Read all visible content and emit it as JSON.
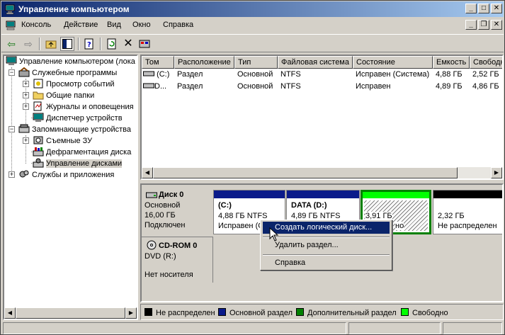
{
  "window": {
    "title": "Управление компьютером"
  },
  "menu": {
    "items": [
      "Консоль",
      "Действие",
      "Вид",
      "Окно",
      "Справка"
    ]
  },
  "tree": {
    "root": "Управление компьютером (лока",
    "system_tools": "Служебные программы",
    "event_viewer": "Просмотр событий",
    "shared_folders": "Общие папки",
    "logs_alerts": "Журналы и оповещения",
    "device_manager": "Диспетчер устройств",
    "storage": "Запоминающие устройства",
    "removable": "Съемные ЗУ",
    "defrag": "Дефрагментация диска",
    "disk_mgmt": "Управление дисками",
    "services_apps": "Службы и приложения"
  },
  "volumes": {
    "columns": [
      "Том",
      "Расположение",
      "Тип",
      "Файловая система",
      "Состояние",
      "Емкость",
      "Свободно"
    ],
    "rows": [
      [
        "(C:)",
        "Раздел",
        "Основной",
        "NTFS",
        "Исправен (Система)",
        "4,88 ГБ",
        "2,52 ГБ"
      ],
      [
        "D...",
        "Раздел",
        "Основной",
        "NTFS",
        "Исправен",
        "4,89 ГБ",
        "4,86 ГБ"
      ]
    ]
  },
  "disks": {
    "disk0": {
      "name": "Диск 0",
      "type": "Основной",
      "size": "16,00 ГБ",
      "state": "Подключен"
    },
    "cdrom": {
      "name": "CD-ROM 0",
      "drive": "DVD (R:)",
      "state": "Нет носителя"
    },
    "partitions": [
      {
        "label": "(C:)",
        "info": "4,88 ГБ NTFS",
        "status": "Исправен (С"
      },
      {
        "label": "DATA  (D:)",
        "info": "4,89 ГБ NTFS",
        "status": ""
      },
      {
        "label": "",
        "info": "3,91 ГБ",
        "status": "но"
      },
      {
        "label": "",
        "info": "2,32 ГБ",
        "status": "Не распределен"
      }
    ]
  },
  "legend": [
    "Не распределен",
    "Основной раздел",
    "Дополнительный раздел",
    "Свободно"
  ],
  "colors": {
    "unallocated": "#000000",
    "primary": "#0a1a8a",
    "extended": "#008000",
    "free": "#00ff00"
  },
  "context_menu": {
    "items": [
      "Создать логический диск...",
      "Удалить раздел...",
      "Справка"
    ]
  }
}
